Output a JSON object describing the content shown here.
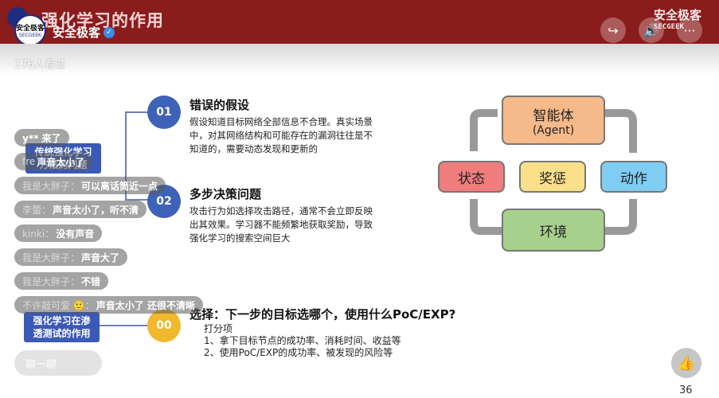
{
  "header": {
    "slide_title": "强化学习的作用",
    "watermark_top": "安全极客",
    "watermark_bottom": "SECGEEK",
    "avatar_line1": "安全极客",
    "avatar_line2": "SECGEEK",
    "channel_name": "安全极客",
    "viewers": "176人看过"
  },
  "buttons": {
    "share_icon": "↪",
    "sound_icon": "🔊",
    "more_icon": "···"
  },
  "slide": {
    "items": [
      {
        "num": "01",
        "title": "错误的假设",
        "body": "假设知道目标网络全部信息不合理。真实场景中，对其网络结构和可能存在的漏洞往往是不知道的，需要动态发现和更新的"
      },
      {
        "num": "02",
        "title": "多步决策问题",
        "body": "攻击行为如选择攻击路径，通常不会立即反映出其效果。学习器不能频繁地获取奖励，导致强化学习的搜索空间巨大"
      },
      {
        "num": "00"
      }
    ],
    "left_tag_1": "传统强化学习方法的问题",
    "left_tag_2": "强化学习在渗透测试的作用",
    "choice": "选择：下一步的目标选哪个，使用什么PoC/EXP?",
    "score": "打分项",
    "line1": "1、拿下目标节点的成功率、消耗时间、收益等",
    "line2": "2、使用PoC/EXP的成功率、被发现的风险等",
    "diagram": {
      "agent": "智能体",
      "agent_en": "(Agent)",
      "state": "状态",
      "reward": "奖惩",
      "action": "动作",
      "env": "环境"
    }
  },
  "colors": {
    "agent": "#f5b98a",
    "state": "#f07d7d",
    "reward": "#fbe08a",
    "action": "#7fcdf2",
    "env": "#a8d08d",
    "blue_circle": "#3e62b8",
    "gold_circle": "#f1b82e"
  },
  "chats": [
    {
      "user": "y** 来了",
      "msg": ""
    },
    {
      "user": "fre",
      "msg": "声音太小了"
    },
    {
      "user": "我是大胖子：",
      "msg": "可以离话筒近一点"
    },
    {
      "user": "李蕾：",
      "msg": "声音太小了，听不清"
    },
    {
      "user": "kinki：",
      "msg": "没有声音"
    },
    {
      "user": "我是大胖子：",
      "msg": "声音大了"
    },
    {
      "user": "我是大胖子：",
      "msg": "不错"
    },
    {
      "user": "不许敲可爱 🙂：",
      "msg": "声音太小了 还很不清晰"
    }
  ],
  "footer": {
    "chat_placeholder": "聊一聊",
    "like_icon": "👍",
    "like_count": "36"
  }
}
